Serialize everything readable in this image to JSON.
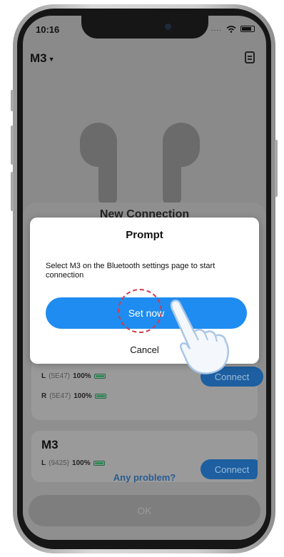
{
  "status_bar": {
    "time": "10:16",
    "signal": "...."
  },
  "header": {
    "device_selector": "M3",
    "caret": "▼"
  },
  "sheet": {
    "title": "New Connection",
    "card1": {
      "left": {
        "side": "L",
        "code": "(5E47)",
        "battery": "100%"
      },
      "right": {
        "side": "R",
        "code": "(5E47)",
        "battery": "100%"
      },
      "connect": "Connect"
    },
    "card2": {
      "name": "M3",
      "left": {
        "side": "L",
        "code": "(9425)",
        "battery": "100%"
      },
      "connect": "Connect"
    }
  },
  "footer": {
    "problem_link": "Any problem?",
    "ok": "OK"
  },
  "modal": {
    "title": "Prompt",
    "message": "Select M3 on the Bluetooth settings page to start connection",
    "primary": "Set now",
    "cancel": "Cancel"
  },
  "colors": {
    "primary_blue": "#1e8cf0",
    "dim_overlay": "#8a8a8a",
    "battery_green": "#2e8b57"
  }
}
